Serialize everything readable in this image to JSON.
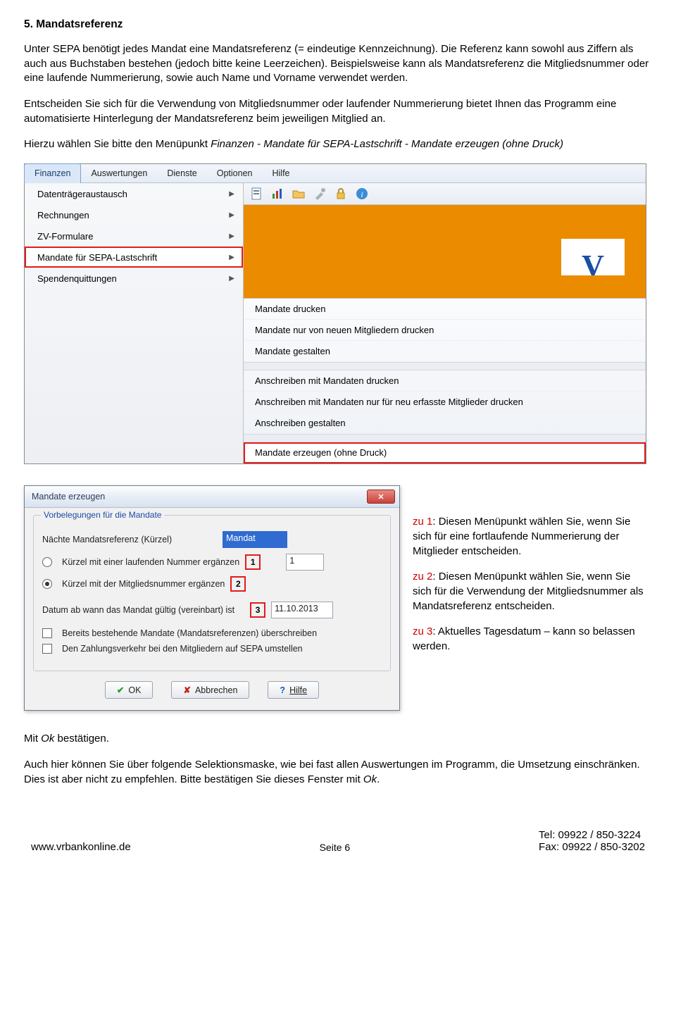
{
  "heading": "5. Mandatsreferenz",
  "para1": "Unter SEPA benötigt jedes Mandat eine Mandatsreferenz (= eindeutige Kennzeichnung). Die Referenz kann sowohl aus Ziffern als auch aus Buchstaben bestehen (jedoch bitte keine Leerzeichen). Beispielsweise kann als Mandatsreferenz die Mitgliedsnummer oder eine laufende Nummerierung, sowie auch Name und Vorname verwendet werden.",
  "para2": "Entscheiden Sie sich für die Verwendung von Mitgliedsnummer oder laufender Nummerierung bietet Ihnen das Programm eine automatisierte Hinterlegung der Mandatsreferenz beim jeweiligen Mitglied an.",
  "para3_a": "Hierzu wählen Sie bitte den Menüpunkt ",
  "para3_i": "Finanzen - Mandate für SEPA-Lastschrift - Mandate erzeugen (ohne Druck)",
  "menubar": [
    "Finanzen",
    "Auswertungen",
    "Dienste",
    "Optionen",
    "Hilfe"
  ],
  "dropdown": [
    "Datenträgeraustausch",
    "Rechnungen",
    "ZV-Formulare",
    "Mandate für SEPA-Lastschrift",
    "Spendenquittungen"
  ],
  "submenu": {
    "top": [
      "Mandate drucken",
      "Mandate nur von neuen Mitgliedern drucken",
      "Mandate gestalten"
    ],
    "mid": [
      "Anschreiben mit Mandaten drucken",
      "Anschreiben mit Mandaten nur für neu erfasste Mitglieder drucken",
      "Anschreiben gestalten"
    ],
    "last": "Mandate erzeugen (ohne Druck)"
  },
  "dialog": {
    "title": "Mandate erzeugen",
    "group": "Vorbelegungen für die Mandate",
    "ref_label": "Nächte Mandatsreferenz (Kürzel)",
    "ref_value": "Mandat",
    "opt1": "Kürzel mit einer laufenden Nummer ergänzen",
    "opt1_num": "1",
    "opt1_field": "1",
    "opt2": "Kürzel mit der Mitgliedsnummer ergänzen",
    "opt2_num": "2",
    "date_label": "Datum ab wann das Mandat gültig (vereinbart) ist",
    "date_num": "3",
    "date_value": "11.10.2013",
    "chk1": "Bereits bestehende Mandate (Mandatsreferenzen) überschreiben",
    "chk2": "Den Zahlungsverkehr bei den Mitgliedern auf SEPA umstellen",
    "btn_ok": "OK",
    "btn_cancel": "Abbrechen",
    "btn_help": "Hilfe"
  },
  "notes": {
    "z1_h": "zu 1",
    "z1": ": Diesen Menüpunkt wählen Sie, wenn Sie sich für eine fortlaufende Nummerierung der Mitglieder entscheiden.",
    "z2_h": "zu 2",
    "z2": ": Diesen Menüpunkt wählen Sie, wenn Sie sich für die Verwendung der Mitgliedsnummer als Mandatsreferenz entscheiden.",
    "z3_h": "zu 3",
    "z3": ": Aktuelles Tagesdatum – kann so belassen werden."
  },
  "after1_a": "Mit ",
  "after1_i": "Ok",
  "after1_b": " bestätigen.",
  "after2_a": "Auch hier können Sie über folgende Selektionsmaske, wie bei fast allen Auswertungen im Programm, die Umsetzung einschränken. Dies ist aber nicht zu empfehlen. Bitte bestätigen Sie dieses Fenster mit ",
  "after2_i": "Ok",
  "after2_b": ".",
  "footer": {
    "url": "www.vrbankonline.de",
    "page": "Seite 6",
    "tel": "Tel: 09922 / 850-3224",
    "fax": "Fax: 09922 / 850-3202"
  }
}
